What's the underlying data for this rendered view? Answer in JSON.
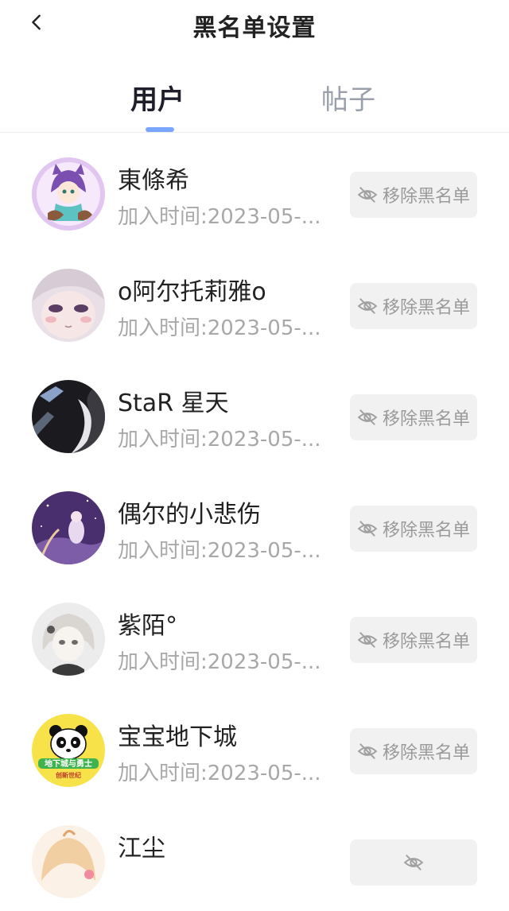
{
  "header": {
    "title": "黑名单设置"
  },
  "tabs": [
    {
      "label": "用户",
      "active": true
    },
    {
      "label": "帖子",
      "active": false
    }
  ],
  "colors": {
    "accent": "#7ba6ff",
    "button_bg": "#f1f1f1",
    "muted": "#a8a8a8"
  },
  "users": [
    {
      "name": "東條希",
      "time": "加入时间:2023-05-...",
      "button": "移除黑名单"
    },
    {
      "name": "o阿尔托莉雅o",
      "time": "加入时间:2023-05-...",
      "button": "移除黑名单"
    },
    {
      "name": "StaR 星天",
      "time": "加入时间:2023-05-...",
      "button": "移除黑名单"
    },
    {
      "name": "偶尔的小悲伤",
      "time": "加入时间:2023-05-...",
      "button": "移除黑名单"
    },
    {
      "name": "紫陌°",
      "time": "加入时间:2023-05-...",
      "button": "移除黑名单"
    },
    {
      "name": "宝宝地下城",
      "time": "加入时间:2023-05-...",
      "button": "移除黑名单"
    },
    {
      "name": "江尘",
      "time": "",
      "button": ""
    }
  ],
  "avatar_texts": {
    "panda_top": "地下城与勇士",
    "panda_bottom": "创新世纪"
  }
}
